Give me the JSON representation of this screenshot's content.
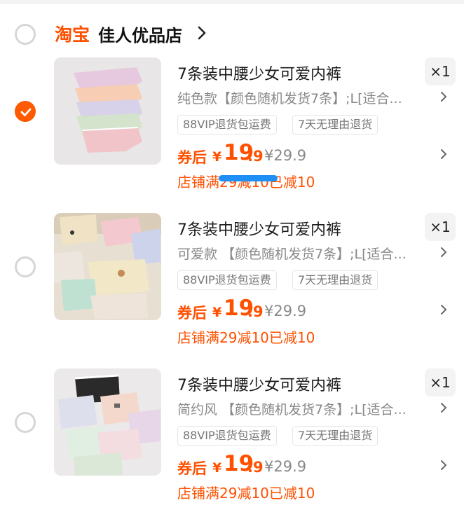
{
  "shop": {
    "logo": "淘宝",
    "name": "佳人优品店"
  },
  "items": [
    {
      "selected": true,
      "title": "7条装中腰少女可爱内裤",
      "qty": "×1",
      "spec": "纯色款【颜色随机发货7条】;L[适合...",
      "tags": [
        "88VIP退货包运费",
        "7天无理由退货"
      ],
      "price_label": "券后",
      "price_currency": "¥",
      "price_int": "19",
      "price_dec": ".9",
      "original_price": "¥29.9",
      "promo": "店铺满29减10已减10"
    },
    {
      "selected": false,
      "title": "7条装中腰少女可爱内裤",
      "qty": "×1",
      "spec": "可爱款 【颜色随机发货7条】;L[适合...",
      "tags": [
        "88VIP退货包运费",
        "7天无理由退货"
      ],
      "price_label": "券后",
      "price_currency": "¥",
      "price_int": "19",
      "price_dec": ".9",
      "original_price": "¥29.9",
      "promo": "店铺满29减10已减10"
    },
    {
      "selected": false,
      "title": "7条装中腰少女可爱内裤",
      "qty": "×1",
      "spec": "简约风 【颜色随机发货7条】;L[适合...",
      "tags": [
        "88VIP退货包运费",
        "7天无理由退货"
      ],
      "price_label": "券后",
      "price_currency": "¥",
      "price_int": "19",
      "price_dec": ".9",
      "original_price": "¥29.9",
      "promo": "店铺满29减10已减10"
    }
  ],
  "icons": {
    "checked": "check-icon",
    "chevron": "chevron-right-icon"
  },
  "colors": {
    "accent": "#ff5000",
    "checkbox_active": "#ff5a00",
    "muted_text": "#888888",
    "tag_border": "#e6e6e6",
    "qty_bg": "#f3f3f3"
  }
}
